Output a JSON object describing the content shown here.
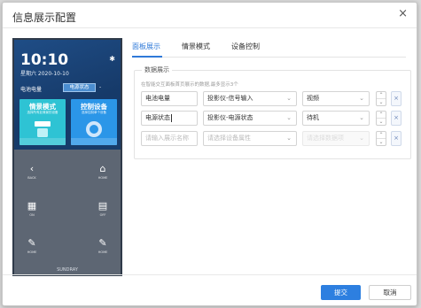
{
  "dialog": {
    "title": "信息展示配置",
    "close_glyph": "×"
  },
  "device": {
    "time": "10:10",
    "date": "星期六 2020-10-10",
    "battery_label": "电池电量",
    "power_badge": "电源状态",
    "power_dash": "-",
    "settings_icon": "gear-icon",
    "cards": [
      {
        "title": "情景模式",
        "subtitle": "选择所有此情景的设备",
        "color": "#2ec3d4",
        "icon": "scene-icon"
      },
      {
        "title": "控制设备",
        "subtitle": "选择控制单个设备",
        "color": "#2b96e8",
        "icon": "ring-icon"
      }
    ],
    "buttons": [
      {
        "glyph": "‹",
        "label": "BACK",
        "icon": "back-icon"
      },
      {
        "glyph": "⌂",
        "label": "HOME",
        "icon": "home-icon"
      },
      {
        "glyph": "▦",
        "label": "ON",
        "icon": "grid-icon"
      },
      {
        "glyph": "▤",
        "label": "OFF",
        "icon": "list-icon"
      },
      {
        "glyph": "✎",
        "label": "HOME",
        "icon": "edit-icon"
      },
      {
        "glyph": "✎",
        "label": "HOME",
        "icon": "edit-icon"
      }
    ],
    "footer": "SUNDRAY"
  },
  "tabs": [
    {
      "label": "面板展示",
      "active": true
    },
    {
      "label": "情景模式",
      "active": false
    },
    {
      "label": "设备控制",
      "active": false
    }
  ],
  "data_display": {
    "legend": "数据展示",
    "hint": "在智能交互面板首页展示的数据,最多显示3个",
    "rows": [
      {
        "name": "电池电量",
        "attribute": "投影仪-信号输入",
        "value": "视频"
      },
      {
        "name": "电源状态",
        "attribute": "投影仪-电源状态",
        "value": "待机"
      },
      {
        "name_placeholder": "请输入展示名称",
        "attribute_placeholder": "请选择设备属性",
        "value_placeholder": "请选择数据项"
      }
    ],
    "stepper_up": "⌃",
    "stepper_down": "⌄",
    "delete_glyph": "×",
    "caret": "⌄"
  },
  "footer": {
    "submit": "提交",
    "cancel": "取消"
  },
  "colors": {
    "accent": "#2d7fe0",
    "card_cyan": "#2ec3d4",
    "card_blue": "#2b96e8",
    "device_frame": "#2f3a49"
  }
}
